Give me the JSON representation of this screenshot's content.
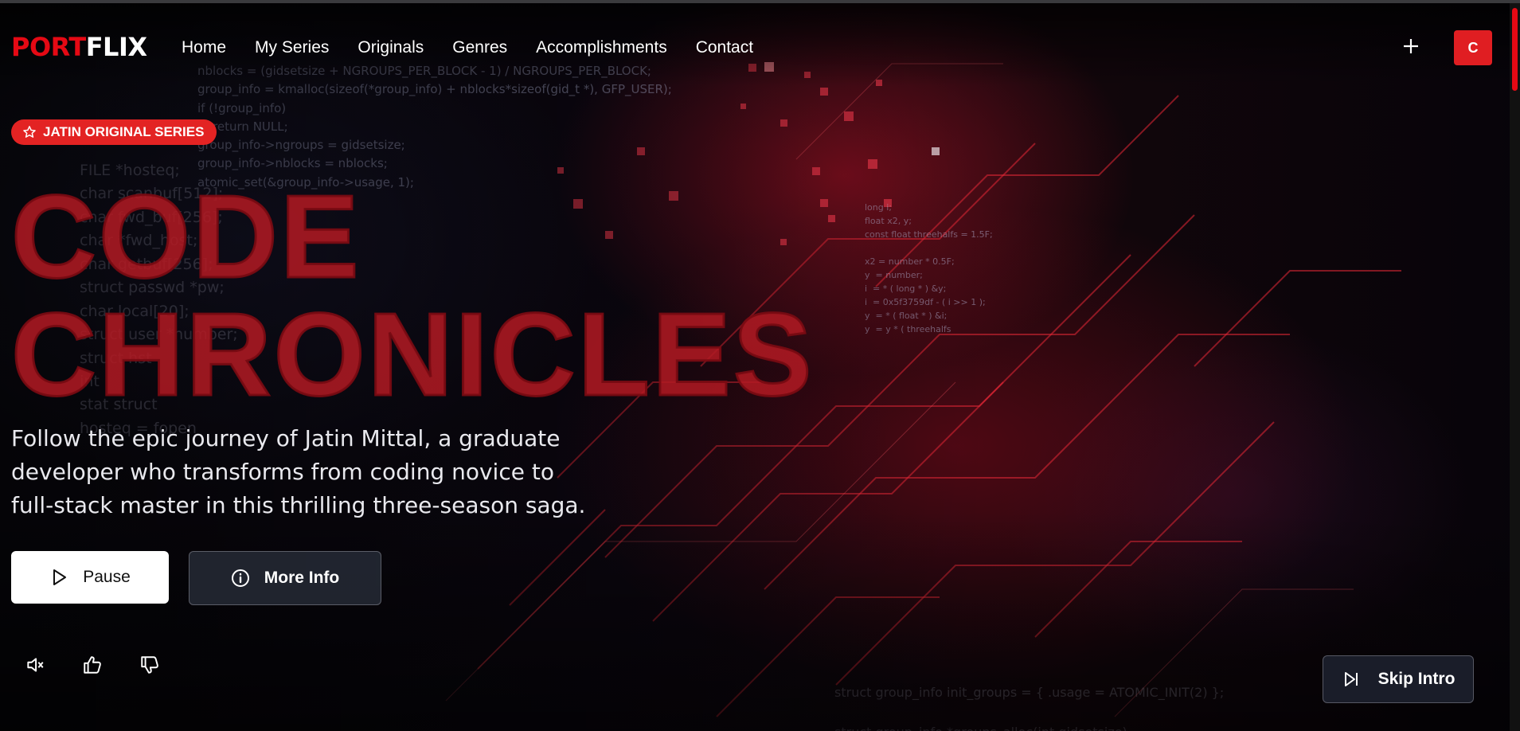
{
  "brand": {
    "logo_part1": "PORT",
    "logo_part2": "FLIX"
  },
  "nav": {
    "items": [
      "Home",
      "My Series",
      "Originals",
      "Genres",
      "Accomplishments",
      "Contact"
    ]
  },
  "header": {
    "add_icon": "plus-icon",
    "avatar_initial": "C"
  },
  "hero": {
    "badge": "JATIN ORIGINAL SERIES",
    "badge_icon": "star-icon",
    "title_line1": "CODE",
    "title_line2": "CHRONICLES",
    "description": "Follow the epic journey of Jatin Mittal, a graduate developer who transforms from coding novice to full-stack master in this thrilling three-season saga.",
    "pause_label": "Pause",
    "pause_icon": "play-icon",
    "more_info_label": "More Info",
    "more_info_icon": "info-icon"
  },
  "controls": {
    "mute_icon": "volume-mute-icon",
    "like_icon": "thumbs-up-icon",
    "dislike_icon": "thumbs-down-icon",
    "skip_label": "Skip Intro",
    "skip_icon": "skip-forward-icon"
  },
  "colors": {
    "accent": "#e50914",
    "badge": "#e32323",
    "avatar": "#e01e22"
  }
}
